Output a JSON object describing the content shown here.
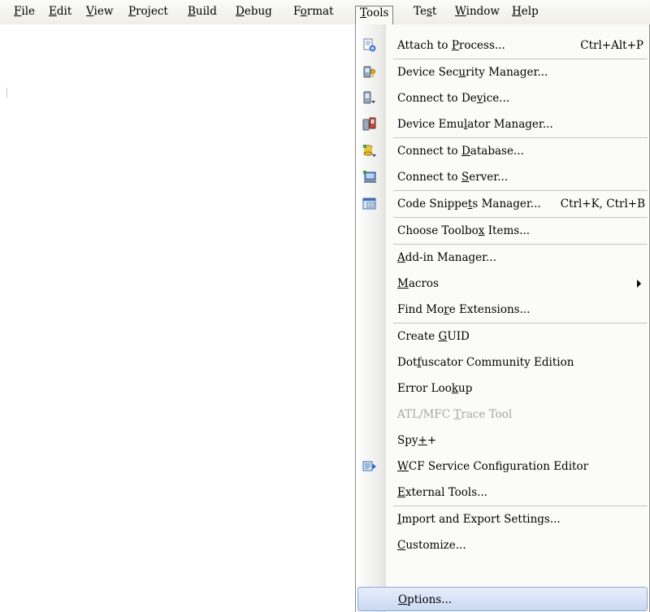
{
  "menubar": {
    "items": [
      {
        "pre": "",
        "mn": "F",
        "post": "ile"
      },
      {
        "pre": "",
        "mn": "E",
        "post": "dit"
      },
      {
        "pre": "",
        "mn": "V",
        "post": "iew"
      },
      {
        "pre": "",
        "mn": "P",
        "post": "roject"
      },
      {
        "pre": "",
        "mn": "B",
        "post": "uild"
      },
      {
        "pre": "",
        "mn": "D",
        "post": "ebug"
      },
      {
        "pre": "F",
        "mn": "o",
        "post": "rmat"
      },
      {
        "pre": "",
        "mn": "T",
        "post": "ools"
      },
      {
        "pre": "Te",
        "mn": "s",
        "post": "t"
      },
      {
        "pre": "",
        "mn": "W",
        "post": "indow"
      },
      {
        "pre": "",
        "mn": "H",
        "post": "elp"
      }
    ]
  },
  "tools_menu": {
    "items": [
      {
        "pre": "Attach to ",
        "mn": "P",
        "post": "rocess...",
        "shortcut": "Ctrl+Alt+P",
        "icon": "attach-process-icon"
      },
      {
        "pre": "Device Sec",
        "mn": "u",
        "post": "rity Manager...",
        "shortcut": "",
        "icon": "device-security-icon"
      },
      {
        "pre": "Connect to De",
        "mn": "v",
        "post": "ice...",
        "shortcut": "",
        "icon": "connect-device-icon"
      },
      {
        "pre": "Device Emu",
        "mn": "l",
        "post": "ator Manager...",
        "shortcut": "",
        "icon": "device-emulator-icon"
      },
      {
        "pre": "Connect to ",
        "mn": "D",
        "post": "atabase...",
        "shortcut": "",
        "icon": "connect-database-icon"
      },
      {
        "pre": "Connect to ",
        "mn": "S",
        "post": "erver...",
        "shortcut": "",
        "icon": "connect-server-icon"
      },
      {
        "pre": "Code Snippe",
        "mn": "t",
        "post": "s Manager...",
        "shortcut": "Ctrl+K, Ctrl+B",
        "icon": "code-snippets-icon"
      },
      {
        "pre": "Choose Toolbo",
        "mn": "x",
        "post": " Items...",
        "shortcut": "",
        "icon": ""
      },
      {
        "pre": "",
        "mn": "A",
        "post": "dd-in Manager...",
        "shortcut": "",
        "icon": ""
      },
      {
        "pre": "",
        "mn": "M",
        "post": "acros",
        "shortcut": "",
        "icon": ""
      },
      {
        "pre": "Find Mo",
        "mn": "r",
        "post": "e Extensions...",
        "shortcut": "",
        "icon": ""
      },
      {
        "pre": "Create ",
        "mn": "G",
        "post": "UID",
        "shortcut": "",
        "icon": ""
      },
      {
        "pre": "Dot",
        "mn": "f",
        "post": "uscator Community Edition",
        "shortcut": "",
        "icon": ""
      },
      {
        "pre": "Error Loo",
        "mn": "k",
        "post": "up",
        "shortcut": "",
        "icon": ""
      },
      {
        "pre": "ATL/MFC ",
        "mn": "T",
        "post": "race Tool",
        "shortcut": "",
        "icon": ""
      },
      {
        "pre": "Spy",
        "mn": "+",
        "post": "+",
        "shortcut": "",
        "icon": ""
      },
      {
        "pre": "",
        "mn": "W",
        "post": "CF Service Configuration Editor",
        "shortcut": "",
        "icon": "wcf-editor-icon"
      },
      {
        "pre": "",
        "mn": "E",
        "post": "xternal Tools...",
        "shortcut": "",
        "icon": ""
      },
      {
        "pre": "",
        "mn": "I",
        "post": "mport and Export Settings...",
        "shortcut": "",
        "icon": ""
      },
      {
        "pre": "",
        "mn": "C",
        "post": "ustomize...",
        "shortcut": "",
        "icon": ""
      },
      {
        "pre": "",
        "mn": "O",
        "post": "ptions...",
        "shortcut": "",
        "icon": ""
      }
    ]
  },
  "colors": {
    "highlight_bg": "#cad9f3",
    "highlight_border": "#8fa9d8",
    "disabled_text": "#a6a6a6"
  }
}
